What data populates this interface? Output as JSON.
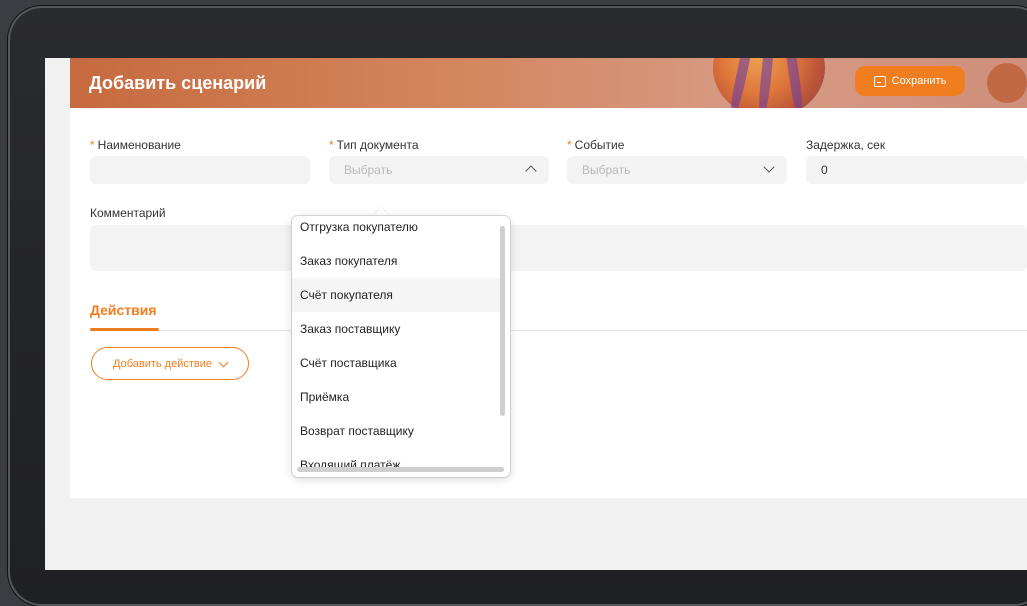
{
  "header": {
    "title": "Добавить сценарий",
    "save_label": "Сохранить"
  },
  "form": {
    "name": {
      "label": "Наименование",
      "value": ""
    },
    "doc_type": {
      "label": "Тип документа",
      "placeholder": "Выбрать"
    },
    "event": {
      "label": "Событие",
      "placeholder": "Выбрать"
    },
    "delay": {
      "label": "Задержка, сек",
      "value": "0"
    },
    "comment": {
      "label": "Комментарий",
      "value": ""
    },
    "required_mark": "*"
  },
  "tabs": {
    "actions_label": "Действия"
  },
  "add_action_label": "Добавить действие",
  "dropdown": {
    "items": [
      "Отгрузка покупателю",
      "Заказ покупателя",
      "Счёт покупателя",
      "Заказ поставщику",
      "Счёт поставщика",
      "Приёмка",
      "Возврат поставщику",
      "Входящий платёж"
    ],
    "hovered_index": 2
  },
  "colors": {
    "accent": "#f07d1f"
  }
}
